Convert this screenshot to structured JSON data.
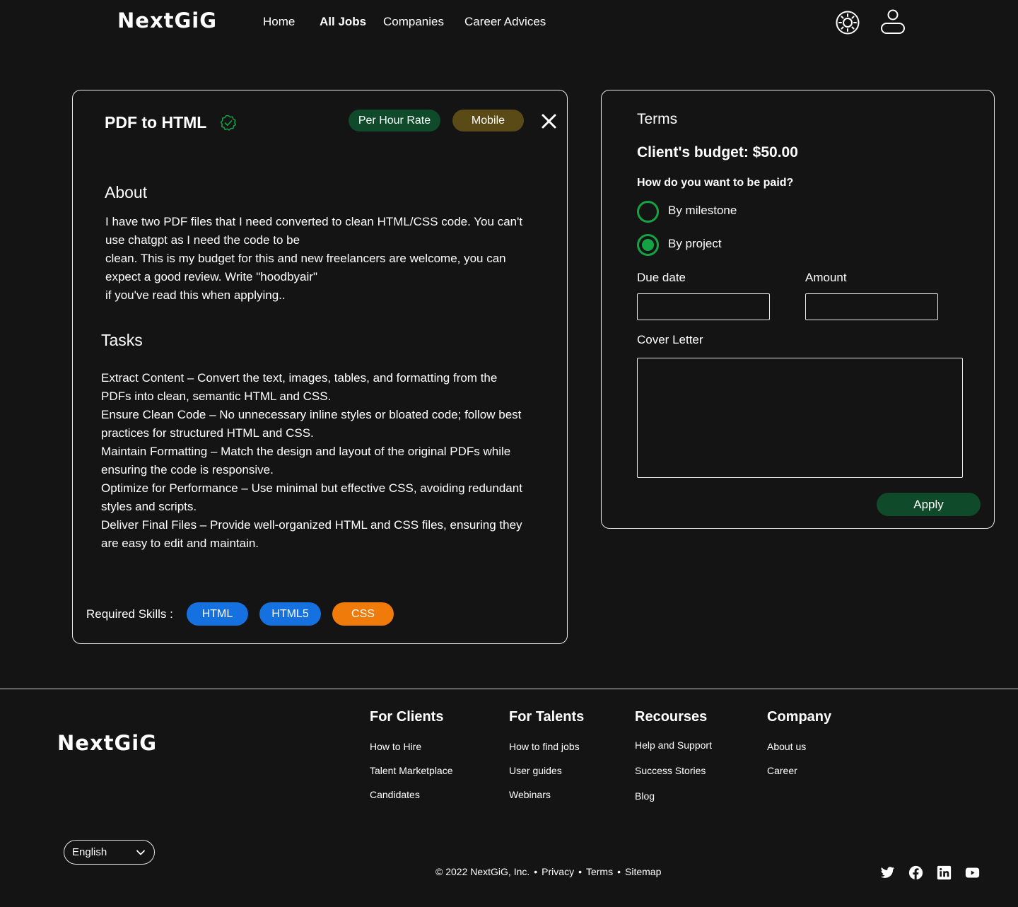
{
  "header": {
    "logo": "NextGiG",
    "nav": [
      "Home",
      "All Jobs",
      "Companies",
      "Career Advices"
    ],
    "active_nav": "All Jobs"
  },
  "job": {
    "title": "PDF to HTML",
    "tags": [
      "Per Hour Rate",
      "Mobile"
    ],
    "about_heading": "About",
    "about_lines": [
      "I have two PDF files that I need converted to clean HTML/CSS code. You can't",
      "use chatgpt as I need the code to be",
      "clean. This is my budget for this and new freelancers are welcome, you can",
      "expect a good review. Write \"hoodbyair\"",
      "if you've read this when applying.."
    ],
    "tasks_heading": "Tasks",
    "tasks_lines": [
      "Extract Content – Convert the text, images, tables, and formatting from the",
      "PDFs into clean, semantic HTML and CSS.",
      "Ensure Clean Code – No unnecessary inline styles or bloated code; follow best",
      "practices for structured HTML and CSS.",
      "Maintain Formatting – Match the design and layout of the original PDFs while",
      "ensuring the code is responsive.",
      "Optimize for Performance – Use minimal but effective CSS, avoiding redundant",
      "styles and scripts.",
      "Deliver Final Files – Provide well-organized HTML and CSS files, ensuring they",
      "are easy to edit and maintain."
    ],
    "skills_label": "Required Skills :",
    "skills": [
      {
        "name": "HTML",
        "color": "#1570e0"
      },
      {
        "name": "HTML5",
        "color": "#1570e0"
      },
      {
        "name": "CSS",
        "color": "#f07a0a"
      }
    ]
  },
  "terms": {
    "heading": "Terms",
    "budget": "Client's budget: $50.00",
    "question": "How do you want to be paid?",
    "options": [
      "By milestone",
      "By project"
    ],
    "selected": "By project",
    "due_date_label": "Due date",
    "due_date_value": "",
    "amount_label": "Amount",
    "amount_value": "",
    "cover_letter_label": "Cover Letter",
    "cover_letter_value": "",
    "apply_label": "Apply"
  },
  "footer": {
    "logo": "NextGiG",
    "columns": [
      {
        "heading": "For Clients",
        "links": [
          "How to Hire",
          "Talent Marketplace",
          "Candidates"
        ]
      },
      {
        "heading": "For Talents",
        "links": [
          "How to find jobs",
          "User guides",
          "Webinars"
        ]
      },
      {
        "heading": "Recourses",
        "links": [
          "Help and Support",
          "Success Stories",
          "Blog"
        ]
      },
      {
        "heading": "Company",
        "links": [
          "About us",
          "Career"
        ]
      }
    ],
    "language": "English",
    "copyright": "© 2022 NextGiG, Inc.",
    "legal_links": [
      "Privacy",
      "Terms",
      "Sitemap"
    ],
    "social_icons": [
      "twitter-icon",
      "facebook-icon",
      "linkedin-icon",
      "youtube-icon"
    ]
  },
  "colors": {
    "background": "#141414",
    "accent_green": "#14a344",
    "button_green": "#0f4a2a",
    "tag_olive": "#5a4a16",
    "skill_blue": "#1570e0",
    "skill_orange": "#f07a0a"
  }
}
